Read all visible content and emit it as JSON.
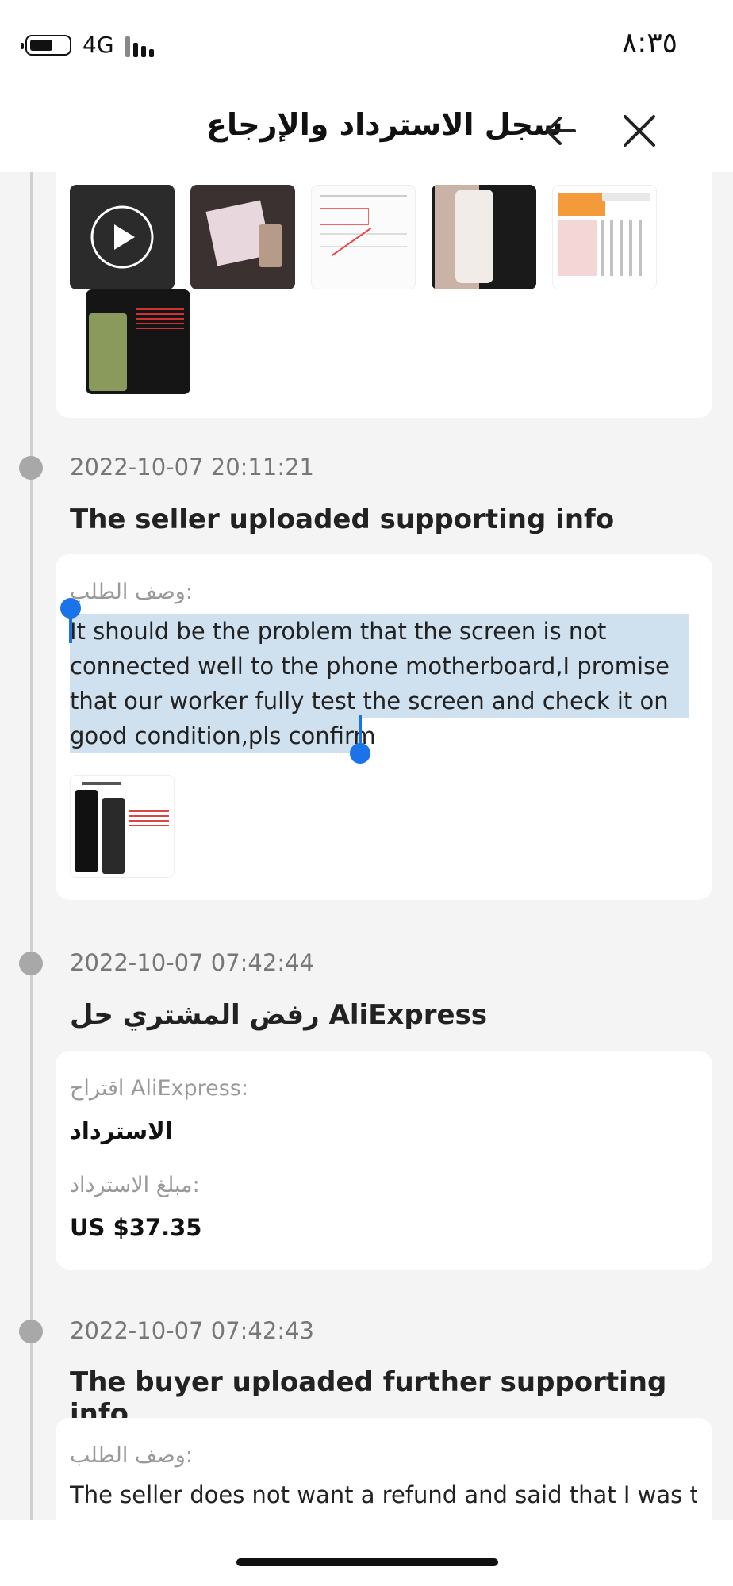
{
  "status_bar": {
    "network": "4G",
    "time": "٨:٣٥"
  },
  "header": {
    "title": "سجل الاسترداد والإرجاع"
  },
  "entries": [
    {
      "time": "2022-10-07 20:11:21",
      "title": "The seller uploaded supporting info",
      "label": "وصف الطلب:",
      "text": "It should be the problem that the screen is not connected well to the phone motherboard,I promise that our worker fully test the screen and check it on good condition,pls confirm"
    },
    {
      "time": "2022-10-07 07:42:44",
      "title": "رفض المشتري حل AliExpress",
      "suggestion_label": "اقتراح AliExpress:",
      "suggestion_value": "الاسترداد",
      "amount_label": "مبلغ الاسترداد:",
      "amount_value": "US $37.35"
    },
    {
      "time": "2022-10-07 07:42:43",
      "title": "The buyer uploaded further supporting info",
      "label": "وصف الطلب:",
      "text": "The seller does not want a refund and said that I was the"
    }
  ]
}
